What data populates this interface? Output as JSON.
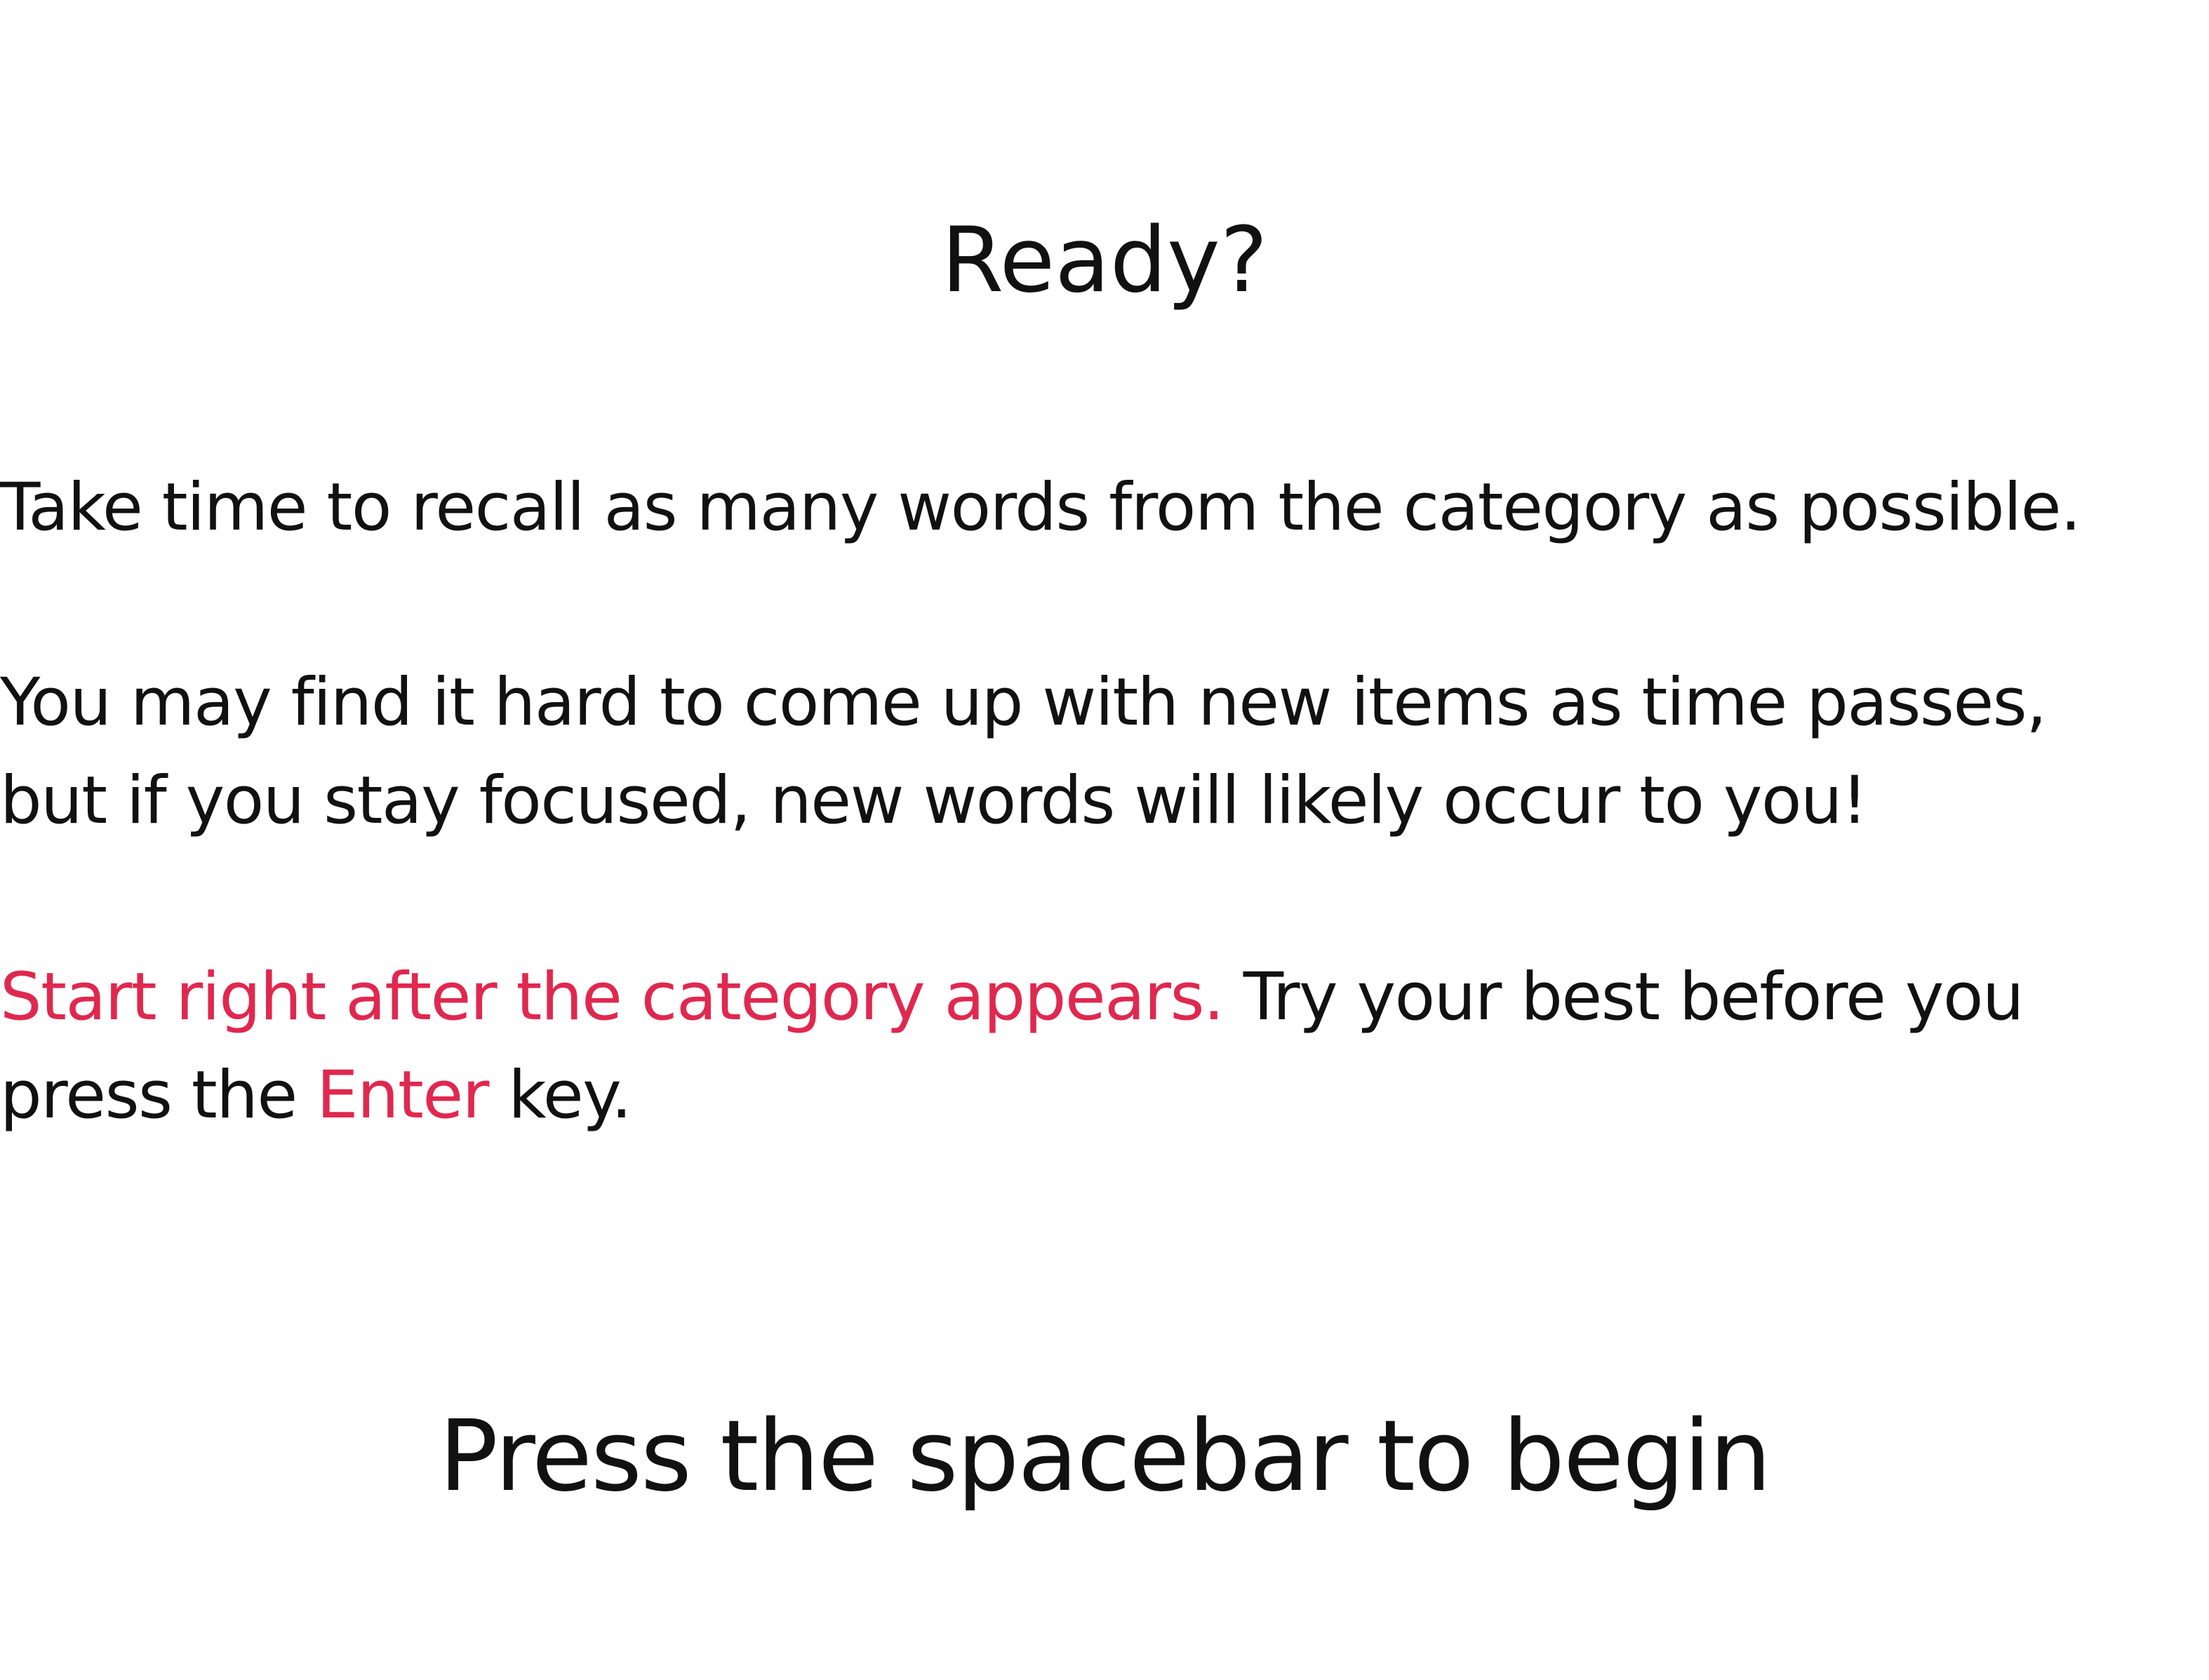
{
  "colors": {
    "background": "#ffffff",
    "text": "#111111",
    "accent": "#e0284f"
  },
  "screen": {
    "title": "Ready?",
    "instruction_1": "Take time to recall as many words from the category as possible.",
    "instruction_2_line_1": "You may find it hard to come up with new items as time passes,",
    "instruction_2_line_2": "but if you stay focused, new words will likely occur to you!",
    "instruction_3": {
      "highlight": "Start right after the category appears.",
      "rest_line_1": " Try your best before you",
      "line_2_pre": "press the ",
      "key_name": "Enter",
      "line_2_post": " key."
    },
    "prompt": "Press the spacebar to begin"
  }
}
